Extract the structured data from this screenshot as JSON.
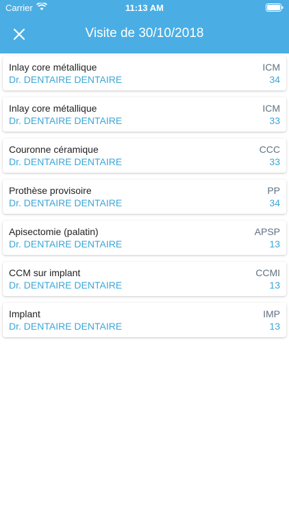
{
  "status_bar": {
    "carrier": "Carrier",
    "time": "11:13 AM",
    "wifi_icon": "wifi-icon",
    "battery_icon": "battery-icon"
  },
  "header": {
    "title": "Visite de 30/10/2018",
    "close_icon": "close-icon",
    "background_color": "#4aaee4"
  },
  "acts": [
    {
      "name": "Inlay core métallique",
      "doctor": "Dr. DENTAIRE DENTAIRE",
      "code": "ICM",
      "tooth": "34"
    },
    {
      "name": "Inlay core métallique",
      "doctor": "Dr. DENTAIRE DENTAIRE",
      "code": "ICM",
      "tooth": "33"
    },
    {
      "name": "Couronne céramique",
      "doctor": "Dr. DENTAIRE DENTAIRE",
      "code": "CCC",
      "tooth": "33"
    },
    {
      "name": "Prothèse provisoire",
      "doctor": "Dr. DENTAIRE DENTAIRE",
      "code": "PP",
      "tooth": "34"
    },
    {
      "name": "Apisectomie (palatin)",
      "doctor": "Dr. DENTAIRE DENTAIRE",
      "code": "APSP",
      "tooth": "13"
    },
    {
      "name": "CCM sur implant",
      "doctor": "Dr. DENTAIRE DENTAIRE",
      "code": "CCMI",
      "tooth": "13"
    },
    {
      "name": "Implant",
      "doctor": "Dr. DENTAIRE DENTAIRE",
      "code": "IMP",
      "tooth": "13"
    }
  ],
  "colors": {
    "accent": "#3aa6d8",
    "text": "#222222",
    "code": "#607080"
  }
}
